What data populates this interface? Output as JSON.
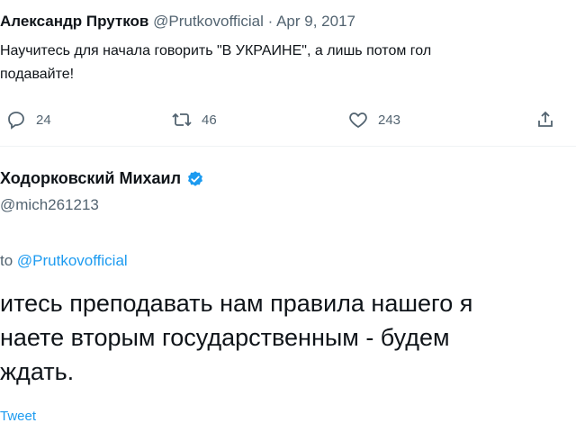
{
  "tweet1": {
    "author_name": "Александр Прутков",
    "author_handle": "@Prutkovofficial",
    "separator": "·",
    "date": "Apr 9, 2017",
    "text_line1": "Научитесь для начала говорить \"В УКРАИНЕ\", а лишь потом гол",
    "text_line2": "подавайте!",
    "reply_count": "24",
    "retweet_count": "46",
    "like_count": "243"
  },
  "tweet2": {
    "author_name": "Ходорковский Михаил",
    "author_handle": "@mich261213",
    "reply_prefix": "to",
    "reply_handle": "@Prutkovofficial",
    "text_line1": "итесь преподавать нам правила нашего я",
    "text_line2": "наете вторым государственным - будем",
    "text_line3": "ждать.",
    "footer_link": "Tweet"
  },
  "colors": {
    "link": "#1d9bf0",
    "muted": "#536471",
    "text": "#0f1419",
    "verified": "#1d9bf0"
  },
  "icons": [
    "reply-icon",
    "retweet-icon",
    "like-icon",
    "share-icon",
    "verified-icon"
  ]
}
